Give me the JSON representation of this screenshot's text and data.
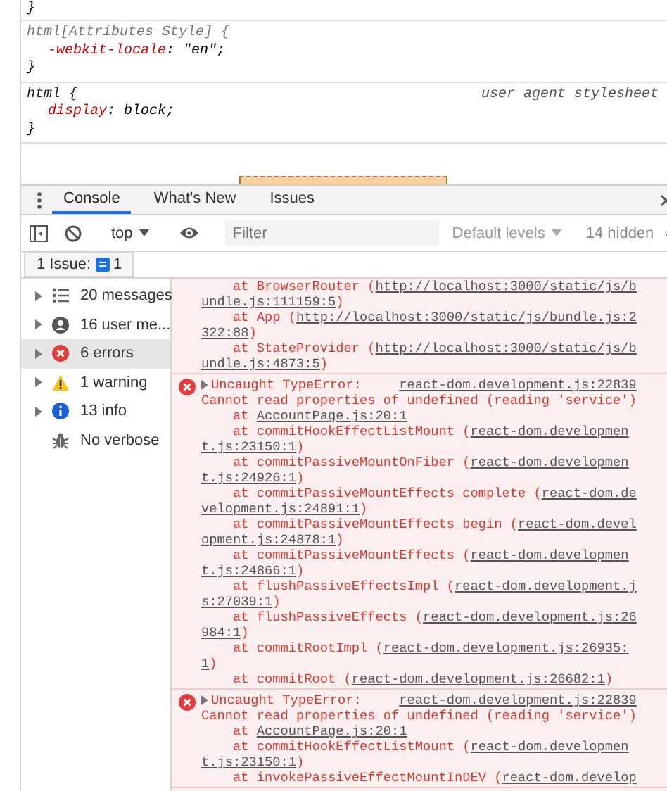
{
  "styles": {
    "closing_brace": "}",
    "rules": [
      {
        "kind": "attributes",
        "selector": "html[Attributes Style] {",
        "declarations": [
          {
            "property": "-webkit-locale",
            "value": ": \"en\";"
          }
        ],
        "close": "}"
      },
      {
        "kind": "user-agent",
        "selector": "html {",
        "origin": "user agent stylesheet",
        "declarations": [
          {
            "property": "display",
            "value": ": block;"
          }
        ],
        "close": "}"
      }
    ]
  },
  "drawer": {
    "tabs": [
      {
        "label": "Console",
        "selected": true
      },
      {
        "label": "What's New",
        "selected": false
      },
      {
        "label": "Issues",
        "selected": false
      }
    ],
    "toolbar": {
      "context": "top",
      "filter": {
        "placeholder": "Filter"
      },
      "levels": "Default levels",
      "hidden": "14 hidden"
    },
    "issues": {
      "label": "1 Issue:",
      "count": "1"
    }
  },
  "sidebar": {
    "items": [
      {
        "kind": "messages",
        "label": "20 messages",
        "expandable": true,
        "selected": false
      },
      {
        "kind": "user",
        "label": "16 user me...",
        "expandable": true,
        "selected": false
      },
      {
        "kind": "errors",
        "label": "6 errors",
        "expandable": true,
        "selected": true
      },
      {
        "kind": "warnings",
        "label": "1 warning",
        "expandable": true,
        "selected": false
      },
      {
        "kind": "info",
        "label": "13 info",
        "expandable": true,
        "selected": false
      },
      {
        "kind": "verbose",
        "label": "No verbose",
        "expandable": false,
        "selected": false
      }
    ]
  },
  "log": {
    "entries": [
      {
        "kind": "continuation",
        "frames": [
          {
            "call": "at BrowserRouter (",
            "link": "http://localhost:3000/static/js/bundle.js:111159:5",
            "close": ")"
          },
          {
            "call": "at App (",
            "link": "http://localhost:3000/static/js/bundle.js:2322:88",
            "close": ")"
          },
          {
            "call": "at StateProvider (",
            "link": "http://localhost:3000/static/js/bundle.js:4873:5",
            "close": ")"
          }
        ]
      },
      {
        "kind": "error",
        "title": "Uncaught TypeError:",
        "source": "react-dom.development.js:22839",
        "message": "Cannot read properties of undefined (reading 'service')",
        "frames": [
          {
            "call": "at ",
            "link": "AccountPage.js:20:1"
          },
          {
            "call": "at commitHookEffectListMount (",
            "link": "react-dom.development.js:23150:1",
            "close": ")"
          },
          {
            "call": "at commitPassiveMountOnFiber (",
            "link": "react-dom.development.js:24926:1",
            "close": ")"
          },
          {
            "call": "at commitPassiveMountEffects_complete (",
            "link": "react-dom.development.js:24891:1",
            "close": ")"
          },
          {
            "call": "at commitPassiveMountEffects_begin (",
            "link": "react-dom.development.js:24878:1",
            "close": ")"
          },
          {
            "call": "at commitPassiveMountEffects (",
            "link": "react-dom.development.js:24866:1",
            "close": ")"
          },
          {
            "call": "at flushPassiveEffectsImpl (",
            "link": "react-dom.development.js:27039:1",
            "close": ")"
          },
          {
            "call": "at flushPassiveEffects (",
            "link": "react-dom.development.js:26984:1",
            "close": ")"
          },
          {
            "call": "at commitRootImpl (",
            "link": "react-dom.development.js:26935:1",
            "close": ")"
          },
          {
            "call": "at commitRoot (",
            "link": "react-dom.development.js:26682:1",
            "close": ")"
          }
        ]
      },
      {
        "kind": "error",
        "title": "Uncaught TypeError:",
        "source": "react-dom.development.js:22839",
        "message": "Cannot read properties of undefined (reading 'service')",
        "frames": [
          {
            "call": "at ",
            "link": "AccountPage.js:20:1"
          },
          {
            "call": "at commitHookEffectListMount (",
            "link": "react-dom.development.js:23150:1",
            "close": ")"
          },
          {
            "call": "at invokePassiveEffectMountInDEV (",
            "link": "react-dom.develop"
          }
        ]
      }
    ]
  }
}
